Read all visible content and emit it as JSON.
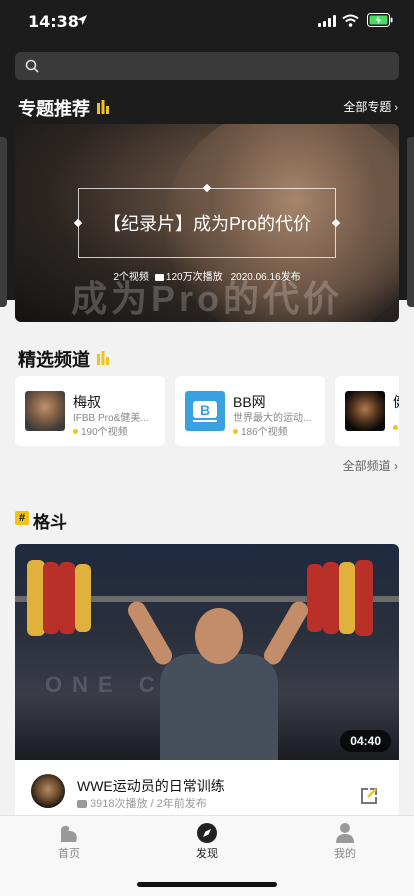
{
  "status_bar": {
    "time": "14:38"
  },
  "search": {
    "placeholder": ""
  },
  "featured": {
    "title": "专题推荐",
    "more_label": "全部专题"
  },
  "banner": {
    "title": "【纪录片】成为Pro的代价",
    "video_count": "2个视频",
    "plays": "120万次播放",
    "published": "2020.06.16发布",
    "watermark": "成为Pro的代价"
  },
  "channels_section": {
    "title": "精选频道",
    "more_label": "全部频道"
  },
  "channels": [
    {
      "name": "梅叔",
      "desc": "IFBB Pro&健美...",
      "count": "190个视频"
    },
    {
      "name": "BB网",
      "desc": "世界最大的运动...",
      "count": "186个视频"
    },
    {
      "name": "健",
      "desc": "",
      "count": ""
    }
  ],
  "category": {
    "hash": "#",
    "title": "格斗"
  },
  "video": {
    "duration": "04:40",
    "title": "WWE运动员的日常训练",
    "plays": "3918次播放",
    "age": "2年前发布"
  },
  "tabs": [
    {
      "label": "首页",
      "icon": "arm-icon"
    },
    {
      "label": "发现",
      "icon": "compass-icon"
    },
    {
      "label": "我的",
      "icon": "person-icon"
    }
  ],
  "colors": {
    "accent": "#f2c31a",
    "dark": "#1c1c1c",
    "background": "#f2f2f2"
  }
}
